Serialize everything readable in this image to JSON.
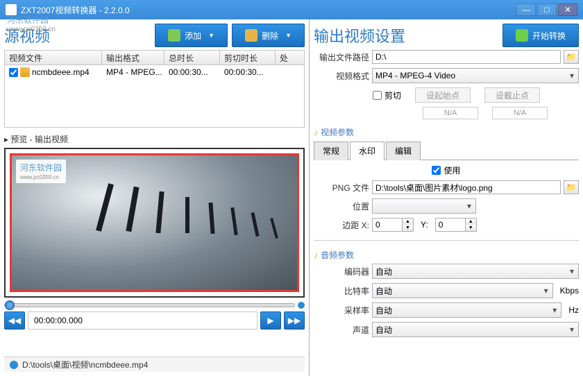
{
  "titlebar": {
    "title": "ZXT2007视频转换器 - 2.2.0.0"
  },
  "watermark": {
    "brand": "河东软件园",
    "url": "www.pc0359.cn"
  },
  "source": {
    "title": "源视频",
    "add_label": "添加",
    "delete_label": "删除",
    "columns": {
      "file": "视频文件",
      "format": "输出格式",
      "duration": "总时长",
      "trim": "剪切时长",
      "proc": "处"
    },
    "rows": [
      {
        "checked": true,
        "name": "ncmbdeee.mp4",
        "format": "MP4 - MPEG...",
        "duration": "00:00:30...",
        "trim": "00:00:30..."
      }
    ],
    "preview_label": "▸ 预览 - 输出视频",
    "timecode": "00:00:00.000"
  },
  "output": {
    "title": "输出视频设置",
    "start_label": "开始转换",
    "path_label": "输出文件路径",
    "path_value": "D:\\",
    "format_label": "视频格式",
    "format_value": "MP4 - MPEG-4 Video",
    "trim_check": "剪切",
    "set_start": "设起始点",
    "set_end": "设截止点",
    "na": "N/A",
    "video_params": "视频参数",
    "tabs": {
      "general": "常规",
      "watermark": "水印",
      "edit": "编辑"
    },
    "use_label": "使用",
    "png_label": "PNG 文件",
    "png_value": "D:\\tools\\桌面\\图片素材\\logo.png",
    "pos_label": "位置",
    "margin_label": "边距 X:",
    "margin_y": "Y:",
    "margin_x_val": "0",
    "margin_y_val": "0",
    "audio_params": "音频参数",
    "encoder_label": "编码器",
    "bitrate_label": "比特率",
    "samplerate_label": "采样率",
    "channel_label": "声道",
    "auto": "自动",
    "kbps": "Kbps",
    "hz": "Hz"
  },
  "statusbar": {
    "path": "D:\\tools\\桌面\\视频\\ncmbdeee.mp4"
  }
}
